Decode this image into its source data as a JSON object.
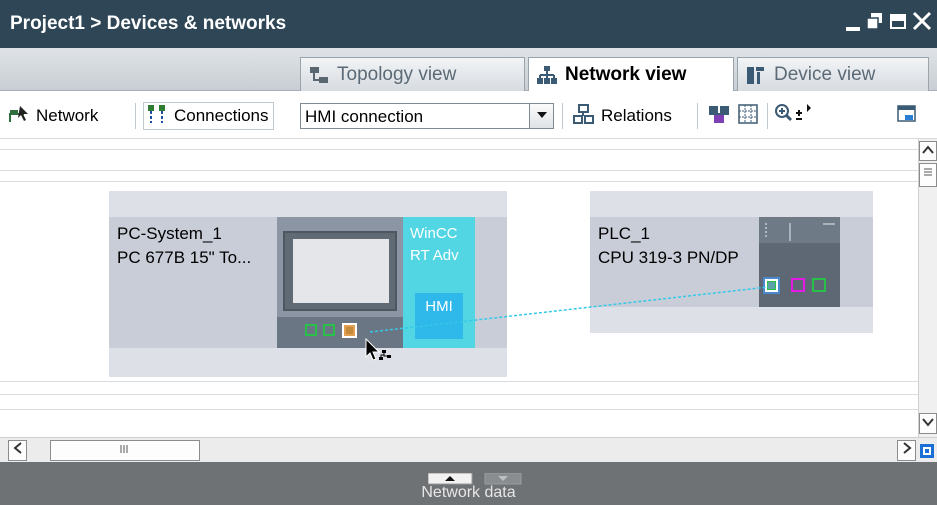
{
  "window": {
    "title": "Project1 > Devices & networks",
    "controls": [
      "minimize-icon",
      "float-icon",
      "maximize-icon",
      "close-icon"
    ]
  },
  "tabs": [
    {
      "label": "Topology view",
      "icon": "topology-icon",
      "active": false
    },
    {
      "label": "Network view",
      "icon": "network-icon",
      "active": true
    },
    {
      "label": "Device view",
      "icon": "device-icon",
      "active": false
    }
  ],
  "toolbar": {
    "network_label": "Network",
    "connections_label": "Connections",
    "connection_type": "HMI connection",
    "relations_label": "Relations"
  },
  "devices": {
    "pc": {
      "name": "PC-System_1",
      "model": "PC 677B 15\" To...",
      "app_line1": "WinCC",
      "app_line2": "RT Adv",
      "app_badge": "HMI"
    },
    "plc": {
      "name": "PLC_1",
      "model": "CPU 319-3 PN/DP"
    }
  },
  "bottom": {
    "panel_label": "Network data"
  },
  "colors": {
    "titlebar": "#2f4656",
    "device_box": "#c9cdd8",
    "wincc_panel": "#53d6e3",
    "port_green": "#29c04a",
    "port_magenta": "#e51ae5",
    "connection_line": "#33c9e8"
  }
}
